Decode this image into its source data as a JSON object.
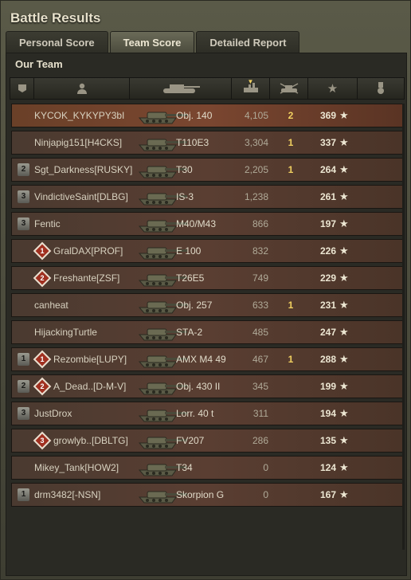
{
  "window": {
    "title": "Battle Results"
  },
  "tabs": [
    {
      "label": "Personal Score",
      "active": false
    },
    {
      "label": "Team Score",
      "active": true
    },
    {
      "label": "Detailed Report",
      "active": false
    }
  ],
  "team": {
    "title": "Our Team"
  },
  "columns": [
    {
      "icon": "squad-icon"
    },
    {
      "icon": "player-icon"
    },
    {
      "icon": "tank-icon"
    },
    {
      "icon": "damage-icon",
      "sorted": true
    },
    {
      "icon": "kills-icon"
    },
    {
      "icon": "xp-star-icon"
    },
    {
      "icon": "medal-icon"
    }
  ],
  "rows": [
    {
      "rank": "",
      "platoon": "",
      "player": "KYCOK_KYKYPY3bI",
      "vehicle": "Obj. 140",
      "damage": "4,105",
      "kills": "2",
      "xp": "369",
      "self": true
    },
    {
      "rank": "",
      "platoon": "",
      "player": "Ninjapig151[H4CKS]",
      "vehicle": "T110E3",
      "damage": "3,304",
      "kills": "1",
      "xp": "337"
    },
    {
      "rank": "2",
      "platoon": "",
      "player": "Sgt_Darkness[RUSKY]",
      "vehicle": "T30",
      "damage": "2,205",
      "kills": "1",
      "xp": "264"
    },
    {
      "rank": "3",
      "platoon": "",
      "player": "VindictiveSaint[DLBG]",
      "vehicle": "IS-3",
      "damage": "1,238",
      "kills": "",
      "xp": "261"
    },
    {
      "rank": "3",
      "platoon": "",
      "player": "Fentic",
      "vehicle": "M40/M43",
      "damage": "866",
      "kills": "",
      "xp": "197"
    },
    {
      "rank": "",
      "platoon": "1",
      "player": "GralDAX[PROF]",
      "vehicle": "E 100",
      "damage": "832",
      "kills": "",
      "xp": "226"
    },
    {
      "rank": "",
      "platoon": "2",
      "player": "Freshante[ZSF]",
      "vehicle": "T26E5",
      "damage": "749",
      "kills": "",
      "xp": "229"
    },
    {
      "rank": "",
      "platoon": "",
      "player": "canheat",
      "vehicle": "Obj. 257",
      "damage": "633",
      "kills": "1",
      "xp": "231"
    },
    {
      "rank": "",
      "platoon": "",
      "player": "HijackingTurtle",
      "vehicle": "STA-2",
      "damage": "485",
      "kills": "",
      "xp": "247"
    },
    {
      "rank": "1",
      "platoon": "1",
      "player": "Rezombie[LUPY]",
      "vehicle": "AMX M4 49",
      "damage": "467",
      "kills": "1",
      "xp": "288"
    },
    {
      "rank": "2",
      "platoon": "2",
      "player": "A_Dead..[D-M-V]",
      "vehicle": "Obj. 430 II",
      "damage": "345",
      "kills": "",
      "xp": "199"
    },
    {
      "rank": "3",
      "platoon": "",
      "player": "JustDrox",
      "vehicle": "Lorr. 40 t",
      "damage": "311",
      "kills": "",
      "xp": "194"
    },
    {
      "rank": "",
      "platoon": "3",
      "player": "growlyb..[DBLTG]",
      "vehicle": "FV207",
      "damage": "286",
      "kills": "",
      "xp": "135"
    },
    {
      "rank": "",
      "platoon": "",
      "player": "Mikey_Tank[HOW2]",
      "vehicle": "T34",
      "damage": "0",
      "kills": "",
      "xp": "124"
    },
    {
      "rank": "1",
      "platoon": "",
      "player": "drm3482[-NSN]",
      "vehicle": "Skorpion G",
      "damage": "0",
      "kills": "",
      "xp": "167"
    }
  ]
}
